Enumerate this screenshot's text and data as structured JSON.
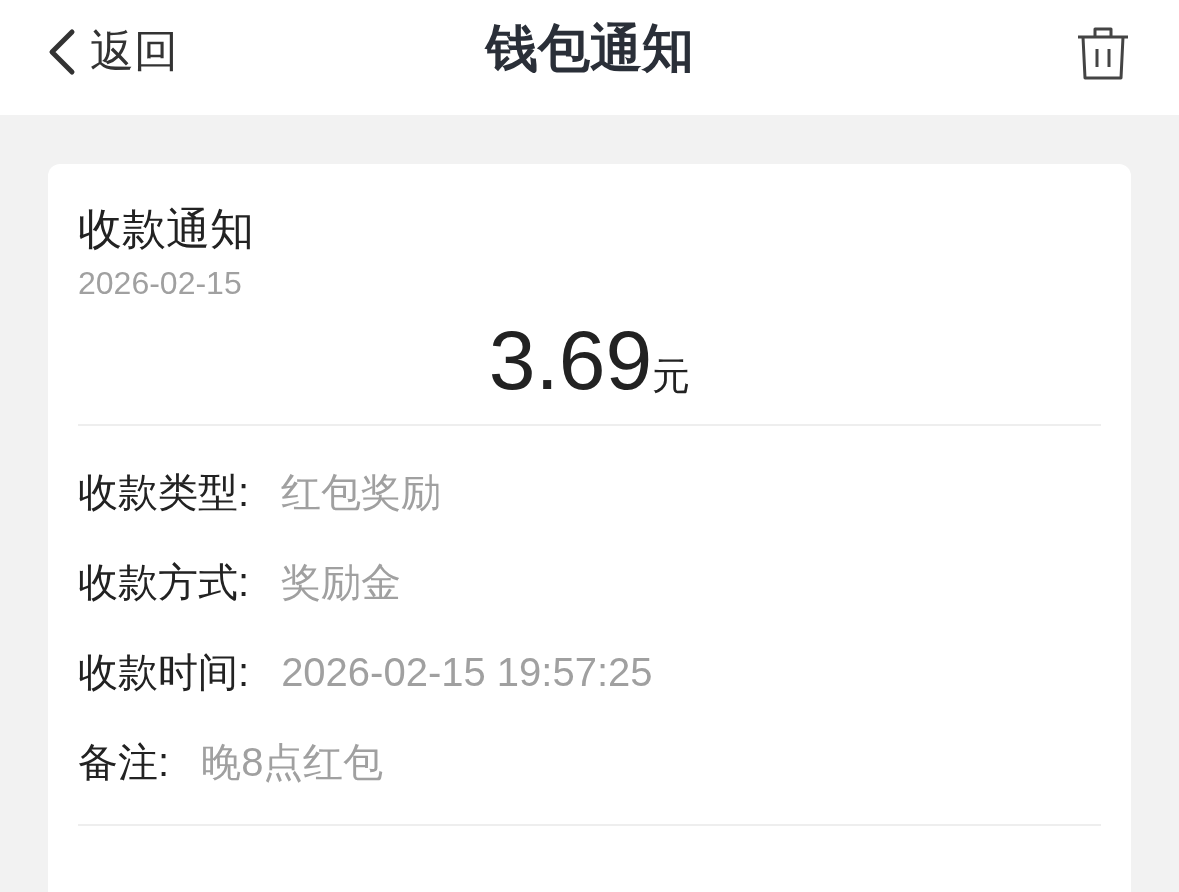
{
  "header": {
    "back_label": "返回",
    "title": "钱包通知"
  },
  "notice": {
    "title": "收款通知",
    "date": "2026-02-15",
    "amount": "3.69",
    "unit": "元",
    "details": [
      {
        "label": "收款类型:",
        "value": "红包奖励"
      },
      {
        "label": "收款方式:",
        "value": "奖励金"
      },
      {
        "label": "收款时间:",
        "value": "2026-02-15 19:57:25"
      },
      {
        "label": "备注:",
        "value": "晚8点红包"
      }
    ]
  }
}
